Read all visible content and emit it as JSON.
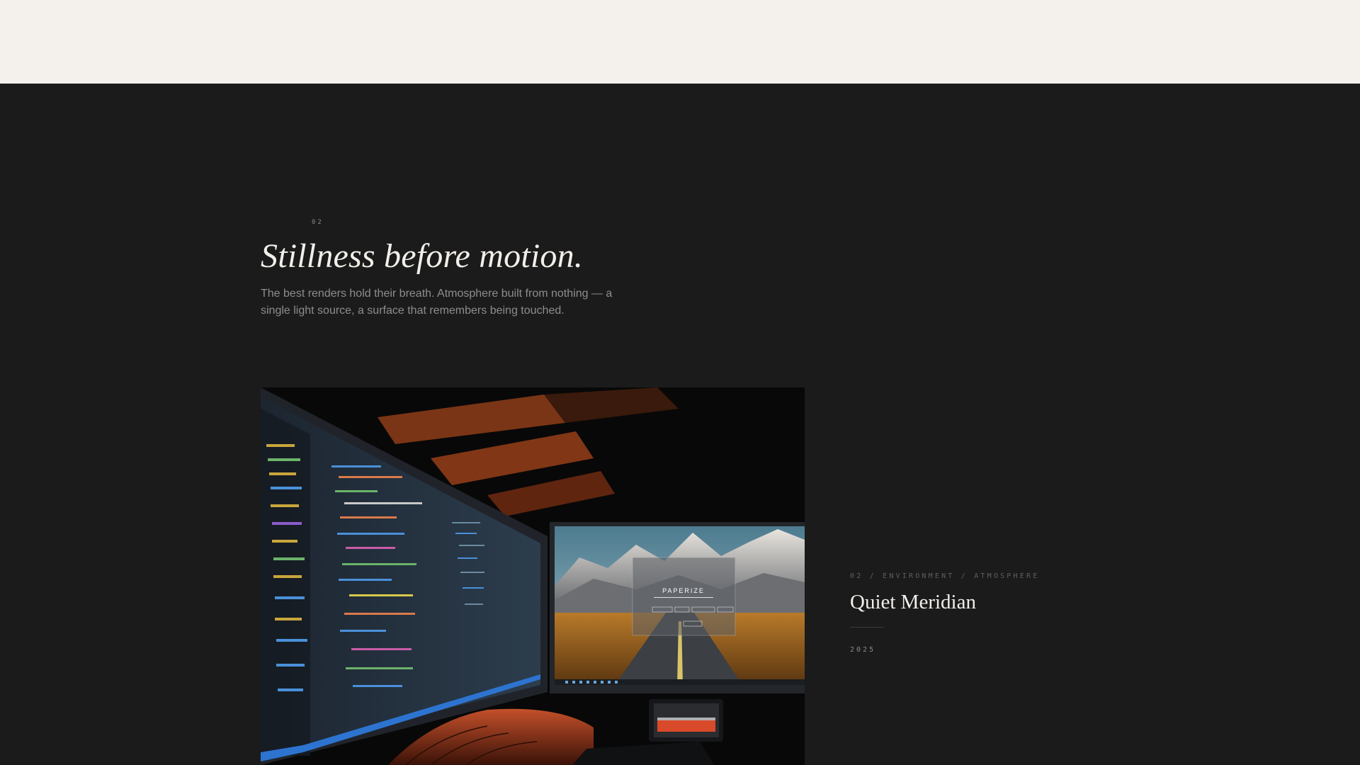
{
  "section": {
    "number": "02",
    "headline": "Stillness before motion.",
    "intro": "The best renders hold their breath. Atmosphere built from nothing — a single light source, a surface that remembers being touched."
  },
  "feature": {
    "image_alt": "Dual-monitor workstation in a dark room",
    "screen_text": "PAPERIZE",
    "kicker": "02 / ENVIRONMENT / ATMOSPHERE",
    "title": "Quiet Meridian",
    "year": "2025"
  },
  "colors": {
    "top_band": "#f4f0ec",
    "background": "#1b1b1b",
    "headline": "#f2efea",
    "body": "#8d8d8d"
  }
}
